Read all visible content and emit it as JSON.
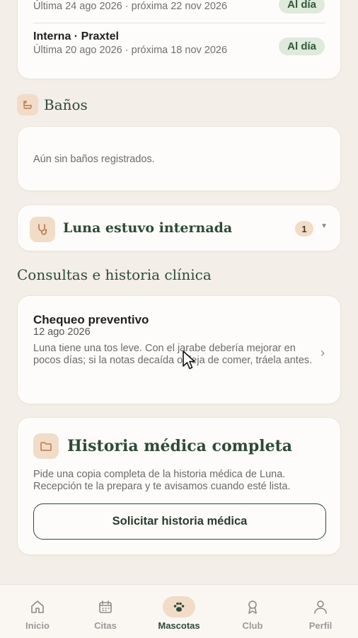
{
  "vaccines": [
    {
      "title": "",
      "subtitle": "Última 24 ago 2026 · próxima 22 nov 2026",
      "status": "Al día"
    },
    {
      "title": "Interna · Praxtel",
      "subtitle": "Última 20 ago 2026 · próxima 18 nov 2026",
      "status": "Al día"
    }
  ],
  "banos": {
    "title": "Baños",
    "empty": "Aún sin baños registrados."
  },
  "internacion": {
    "title": "Luna estuvo internada",
    "count": "1"
  },
  "consultas": {
    "title": "Consultas e historia clínica",
    "items": [
      {
        "name": "Chequeo preventivo",
        "date": "12 ago 2026",
        "text": "Luna tiene una tos leve. Con el jarabe debería mejorar en pocos días; si la notas decaída o deja de comer, tráela antes."
      }
    ]
  },
  "historia": {
    "title": "Historia médica completa",
    "description": "Pide una copia completa de la historia médica de Luna. Recepción te la prepara y te avisamos cuando esté lista.",
    "button": "Solicitar historia médica"
  },
  "nav": [
    {
      "label": "Inicio",
      "icon": "home-icon"
    },
    {
      "label": "Citas",
      "icon": "calendar-icon"
    },
    {
      "label": "Mascotas",
      "icon": "paw-icon",
      "active": true
    },
    {
      "label": "Club",
      "icon": "award-icon"
    },
    {
      "label": "Perfil",
      "icon": "user-icon"
    }
  ],
  "colors": {
    "background": "#f3eee7",
    "accent_green": "#2f4a38",
    "accent_peach": "#f1dcc8",
    "status_pill": "#dfe9dc"
  }
}
